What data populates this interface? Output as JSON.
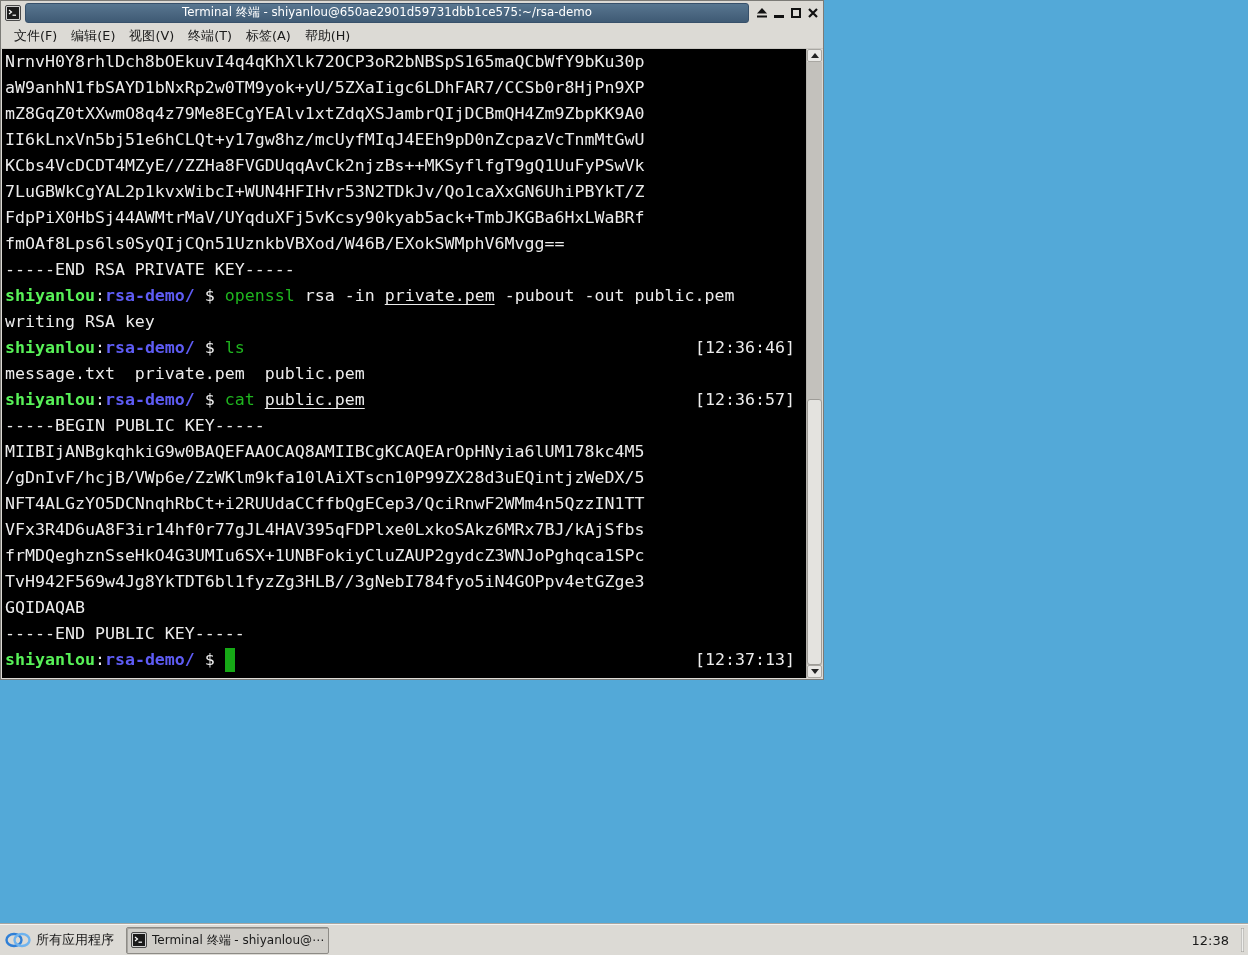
{
  "window": {
    "title": "Terminal 终端 - shiyanlou@650ae2901d59731dbb1ce575:~/rsa-demo"
  },
  "menu": [
    "文件(F)",
    "编辑(E)",
    "视图(V)",
    "终端(T)",
    "标签(A)",
    "帮助(H)"
  ],
  "terminal": {
    "lines": [
      {
        "kind": "output",
        "text": "NrnvH0Y8rhlDch8bOEkuvI4q4qKhXlk72OCP3oR2bNBSpS165maQCbWfY9bKu30p"
      },
      {
        "kind": "output",
        "text": "aW9anhN1fbSAYD1bNxRp2w0TM9yok+yU/5ZXaIigc6LDhFAR7/CCSb0r8HjPn9XP"
      },
      {
        "kind": "output",
        "text": "mZ8GqZ0tXXwmO8q4z79Me8ECgYEAlv1xtZdqXSJambrQIjDCBmQH4Zm9ZbpKK9A0"
      },
      {
        "kind": "output",
        "text": "II6kLnxVn5bj51e6hCLQt+y17gw8hz/mcUyfMIqJ4EEh9pD0nZcpazVcTnmMtGwU"
      },
      {
        "kind": "output",
        "text": "KCbs4VcDCDT4MZyE//ZZHa8FVGDUqqAvCk2njzBs++MKSyflfgT9gQ1UuFyPSwVk"
      },
      {
        "kind": "output",
        "text": "7LuGBWkCgYAL2p1kvxWibcI+WUN4HFIHvr53N2TDkJv/Qo1caXxGN6UhiPBYkT/Z"
      },
      {
        "kind": "output",
        "text": "FdpPiX0HbSj44AWMtrMaV/UYqduXFj5vKcsy90kyab5ack+TmbJKGBa6HxLWaBRf"
      },
      {
        "kind": "output",
        "text": "fmOAf8Lps6ls0SyQIjCQn51UznkbVBXod/W46B/EXokSWMphV6Mvgg=="
      },
      {
        "kind": "output",
        "text": "-----END RSA PRIVATE KEY-----"
      },
      {
        "kind": "prompt",
        "user": "shiyanlou",
        "separator": ":",
        "path": "rsa-demo/",
        "symbol": "$",
        "command": "openssl",
        "arguments": [
          {
            "text": "rsa",
            "underlined": false
          },
          {
            "text": "-in",
            "underlined": false
          },
          {
            "text": "private.pem",
            "underlined": true
          },
          {
            "text": "-pubout",
            "underlined": false
          },
          {
            "text": "-out",
            "underlined": false
          },
          {
            "text": "public.pem",
            "underlined": false
          }
        ],
        "cursor": false
      },
      {
        "kind": "output",
        "text": "writing RSA key"
      },
      {
        "kind": "prompt",
        "user": "shiyanlou",
        "separator": ":",
        "path": "rsa-demo/",
        "symbol": "$",
        "command": "ls",
        "time": "[12:36:46]",
        "cursor": false
      },
      {
        "kind": "output",
        "text": "message.txt  private.pem  public.pem"
      },
      {
        "kind": "prompt",
        "user": "shiyanlou",
        "separator": ":",
        "path": "rsa-demo/",
        "symbol": "$",
        "command": "cat",
        "arguments": [
          {
            "text": "public.pem",
            "underlined": true
          }
        ],
        "time": "[12:36:57]",
        "cursor": false
      },
      {
        "kind": "output",
        "text": "-----BEGIN PUBLIC KEY-----"
      },
      {
        "kind": "output",
        "text": "MIIBIjANBgkqhkiG9w0BAQEFAAOCAQ8AMIIBCgKCAQEArOpHNyia6lUM178kc4M5"
      },
      {
        "kind": "output",
        "text": "/gDnIvF/hcjB/VWp6e/ZzWKlm9kfa10lAiXTscn10P99ZX28d3uEQintjzWeDX/5"
      },
      {
        "kind": "output",
        "text": "NFT4ALGzYO5DCNnqhRbCt+i2RUUdaCCffbQgECep3/QciRnwF2WMm4n5QzzIN1TT"
      },
      {
        "kind": "output",
        "text": "VFx3R4D6uA8F3ir14hf0r77gJL4HAV395qFDPlxe0LxkoSAkz6MRx7BJ/kAjSfbs"
      },
      {
        "kind": "output",
        "text": "frMDQeghznSseHkO4G3UMIu6SX+1UNBFokiyCluZAUP2gydcZ3WNJoPghqca1SPc"
      },
      {
        "kind": "output",
        "text": "TvH942F569w4Jg8YkTDT6bl1fyzZg3HLB//3gNebI784fyo5iN4GOPpv4etGZge3"
      },
      {
        "kind": "output",
        "text": "GQIDAQAB"
      },
      {
        "kind": "output",
        "text": "-----END PUBLIC KEY-----"
      },
      {
        "kind": "prompt",
        "user": "shiyanlou",
        "separator": ":",
        "path": "rsa-demo/",
        "symbol": "$",
        "time": "[12:37:13]",
        "cursor": true
      }
    ]
  },
  "taskbar": {
    "start_menu": "所有应用程序",
    "tasks": [
      {
        "label": "Terminal 终端 - shiyanlou@⋯",
        "selected": true
      }
    ],
    "clock": "12:38"
  }
}
